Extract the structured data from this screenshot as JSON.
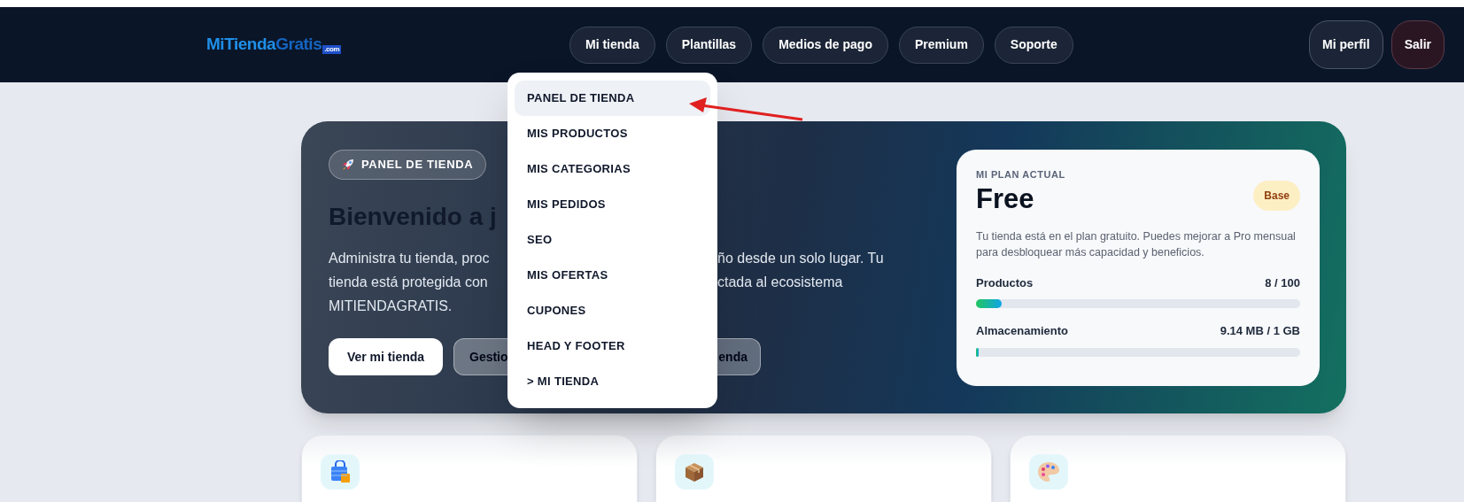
{
  "header": {
    "logo": {
      "main": "MiTienda",
      "accent": "Gratis",
      "suffix": ".com"
    },
    "nav": [
      {
        "label": "Mi tienda"
      },
      {
        "label": "Plantillas"
      },
      {
        "label": "Medios de pago"
      },
      {
        "label": "Premium"
      },
      {
        "label": "Soporte"
      }
    ],
    "account_buttons": [
      {
        "label": "Mi perfil",
        "kind": "profile"
      },
      {
        "label": "Salir",
        "kind": "logout"
      }
    ]
  },
  "dropdown": {
    "items": [
      {
        "label": "PANEL DE TIENDA",
        "selected": true
      },
      {
        "label": "MIS PRODUCTOS",
        "selected": false
      },
      {
        "label": "MIS CATEGORIAS",
        "selected": false
      },
      {
        "label": "MIS PEDIDOS",
        "selected": false
      },
      {
        "label": "SEO",
        "selected": false
      },
      {
        "label": "MIS OFERTAS",
        "selected": false
      },
      {
        "label": "CUPONES",
        "selected": false
      },
      {
        "label": "HEAD Y FOOTER",
        "selected": false
      },
      {
        "label": "> MI TIENDA",
        "selected": false
      }
    ]
  },
  "hero": {
    "badge": "PANEL DE TIENDA",
    "heading": "Bienvenido a j",
    "description_lines": [
      {
        "left": "Administra tu tienda, proc",
        "right": "ño desde un solo lugar. Tu"
      },
      {
        "left": "tienda está protegida con",
        "right": "ctada al ecosistema"
      },
      {
        "left": "MITIENDAGRATIS."
      }
    ],
    "buttons": [
      {
        "kind": "primary",
        "label": "Ver mi tienda"
      },
      {
        "kind": "secondary",
        "label_start": "Gestio",
        "label_end": "enda"
      }
    ]
  },
  "plan_card": {
    "eyebrow": "MI PLAN ACTUAL",
    "plan": "Free",
    "badge": "Base",
    "description": "Tu tienda está en el plan gratuito. Puedes mejorar a Pro mensual para desbloquear más capacidad y beneficios.",
    "meters": [
      {
        "label": "Productos",
        "reading": "8 / 100",
        "level": 0.08
      },
      {
        "label": "Almacenamiento",
        "reading": "9.14 MB / 1 GB",
        "level": 0.009
      }
    ]
  },
  "feature_cards": [
    {
      "kind": "bag"
    },
    {
      "kind": "box"
    },
    {
      "kind": "palette"
    }
  ]
}
